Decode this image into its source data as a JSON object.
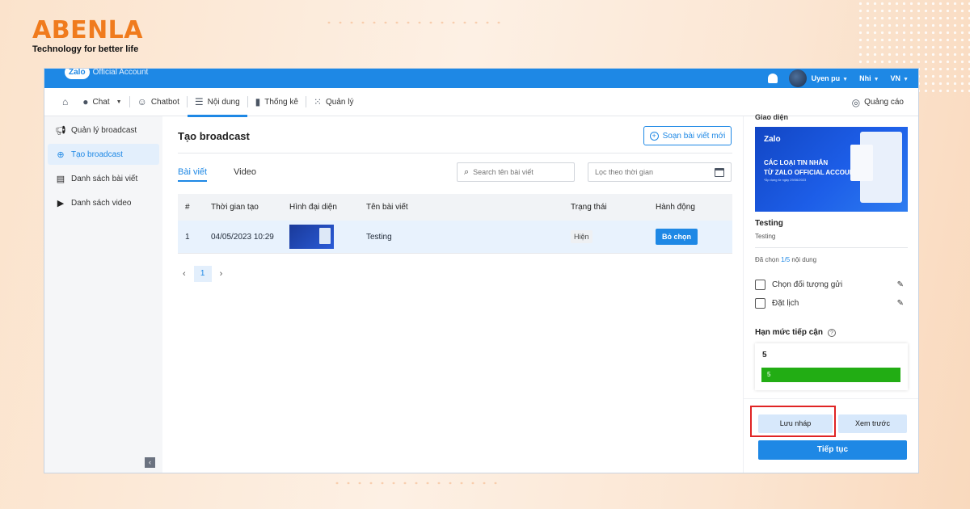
{
  "brand": {
    "name": "ABENLA",
    "tagline": "Technology for better life"
  },
  "topbar": {
    "logo_badge": "Zalo",
    "logo_text": "Official Account",
    "user_name": "Uyen pu",
    "lang1": "Nhi",
    "lang2": "VN"
  },
  "nav": {
    "items": [
      {
        "label": "Chat",
        "icon": "chat-icon"
      },
      {
        "label": "Chatbot",
        "icon": "bot-icon"
      },
      {
        "label": "Nội dung",
        "icon": "list-icon"
      },
      {
        "label": "Thống kê",
        "icon": "chart-icon"
      },
      {
        "label": "Quản lý",
        "icon": "grid-icon"
      }
    ],
    "ads_label": "Quảng cáo"
  },
  "sidebar": {
    "items": [
      {
        "label": "Quản lý broadcast",
        "icon": "megaphone-icon"
      },
      {
        "label": "Tạo broadcast",
        "icon": "plus-circle-icon"
      },
      {
        "label": "Danh sách bài viết",
        "icon": "article-icon"
      },
      {
        "label": "Danh sách video",
        "icon": "video-icon"
      }
    ]
  },
  "main": {
    "title": "Tạo broadcast",
    "compose_label": "Soạn bài viết mới",
    "tabs": [
      "Bài viết",
      "Video"
    ],
    "search_placeholder": "Search tên bài viết",
    "date_placeholder": "Lọc theo thời gian",
    "table": {
      "headers": [
        "#",
        "Thời gian tạo",
        "Hình đại diện",
        "Tên bài viết",
        "Trạng thái",
        "Hành động"
      ],
      "rows": [
        {
          "index": "1",
          "created": "04/05/2023 10:29",
          "name": "Testing",
          "status": "Hiện",
          "action": "Bỏ chọn"
        }
      ]
    },
    "pager": {
      "prev": "‹",
      "page": "1",
      "next": "›"
    }
  },
  "panel": {
    "section_label": "Giao diện",
    "banner": {
      "brand": "Zalo",
      "line1": "CÁC LOẠI TIN NHẮN",
      "line2": "TỪ ZALO OFFICIAL ACCOUNT",
      "line3": "*Áp dụng từ ngày 29/06/2023"
    },
    "post_title": "Testing",
    "post_sub": "Testing",
    "selected_prefix": "Đã chọn ",
    "selected_count": "1/5",
    "selected_suffix": " nội dung",
    "checks": [
      "Chọn đối tượng gửi",
      "Đặt lịch"
    ],
    "limit_label": "Hạn mức tiếp cận",
    "limit_value": "5",
    "limit_bar_value": "5",
    "draft_label": "Lưu nháp",
    "preview_label": "Xem trước",
    "continue_label": "Tiếp tục"
  },
  "colors": {
    "primary": "#1e88e5",
    "brand_orange": "#f07b1d",
    "success": "#22ad14",
    "highlight": "#e02424"
  }
}
